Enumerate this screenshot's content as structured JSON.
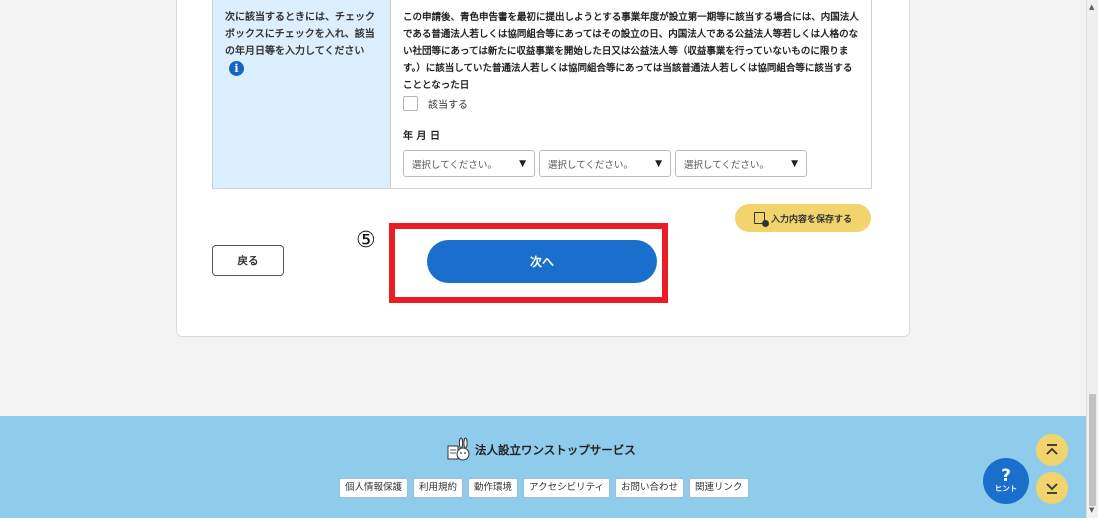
{
  "form": {
    "label_text": "次に該当するときには、チェックボックスにチェックを入れ、該当の年月日等を入力してください",
    "info_icon": "i",
    "description": "この申請後、青色申告書を最初に提出しようとする事業年度が設立第一期等に該当する場合には、内国法人である普通法人若しくは協同組合等にあってはその設立の日、内国法人である公益法人等若しくは人格のない社団等にあっては新たに収益事業を開始した日又は公益法人等（収益事業を行っていないものに限ります。）に該当していた普通法人若しくは協同組合等にあっては当該普通法人若しくは協同組合等に該当することとなった日",
    "checkbox_label": "該当する",
    "checkbox_checked": false,
    "date_label": "年 月 日",
    "selects": [
      {
        "value": "選択してください。"
      },
      {
        "value": "選択してください。"
      },
      {
        "value": "選択してください。"
      }
    ],
    "select_arrow": "▼"
  },
  "actions": {
    "save_label": "入力内容を保存する",
    "back_label": "戻る",
    "next_label": "次へ",
    "step_marker": "⑤"
  },
  "footer": {
    "title": "法人設立ワンストップサービス",
    "links": [
      "個人情報保護",
      "利用規約",
      "動作環境",
      "アクセシビリティ",
      "お問い合わせ",
      "関連リンク"
    ],
    "hint_q": "?",
    "hint_label": "ヒント"
  },
  "colors": {
    "primary": "#1a6fcc",
    "accent_yellow": "#f2d46c",
    "highlight_red": "#ec1c24",
    "footer_bg": "#8fccec",
    "label_bg": "#dcefff"
  }
}
